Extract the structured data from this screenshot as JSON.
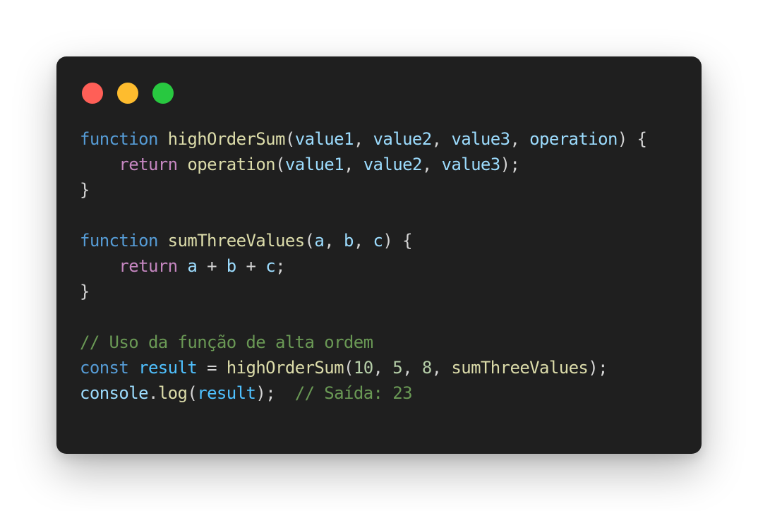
{
  "window": {
    "buttons": [
      {
        "name": "close",
        "color": "#ff5f57"
      },
      {
        "name": "minimize",
        "color": "#febc2e"
      },
      {
        "name": "zoom",
        "color": "#28c840"
      }
    ]
  },
  "colors": {
    "keyword": "#569cd6",
    "control": "#c586c0",
    "function": "#dcdcaa",
    "variable": "#9cdcfe",
    "number": "#b5cea8",
    "comment": "#6a9955",
    "punctuation": "#d4d4d4",
    "const": "#4fc1ff"
  },
  "code": {
    "lines": [
      [
        {
          "t": "function",
          "c": "keyword"
        },
        {
          "t": " ",
          "c": "punctuation"
        },
        {
          "t": "highOrderSum",
          "c": "function"
        },
        {
          "t": "(",
          "c": "punctuation"
        },
        {
          "t": "value1",
          "c": "variable"
        },
        {
          "t": ", ",
          "c": "punctuation"
        },
        {
          "t": "value2",
          "c": "variable"
        },
        {
          "t": ", ",
          "c": "punctuation"
        },
        {
          "t": "value3",
          "c": "variable"
        },
        {
          "t": ", ",
          "c": "punctuation"
        },
        {
          "t": "operation",
          "c": "variable"
        },
        {
          "t": ") {",
          "c": "punctuation"
        }
      ],
      [
        {
          "t": "    ",
          "c": "punctuation"
        },
        {
          "t": "return",
          "c": "control"
        },
        {
          "t": " ",
          "c": "punctuation"
        },
        {
          "t": "operation",
          "c": "function"
        },
        {
          "t": "(",
          "c": "punctuation"
        },
        {
          "t": "value1",
          "c": "variable"
        },
        {
          "t": ", ",
          "c": "punctuation"
        },
        {
          "t": "value2",
          "c": "variable"
        },
        {
          "t": ", ",
          "c": "punctuation"
        },
        {
          "t": "value3",
          "c": "variable"
        },
        {
          "t": ");",
          "c": "punctuation"
        }
      ],
      [
        {
          "t": "}",
          "c": "punctuation"
        }
      ],
      [],
      [
        {
          "t": "function",
          "c": "keyword"
        },
        {
          "t": " ",
          "c": "punctuation"
        },
        {
          "t": "sumThreeValues",
          "c": "function"
        },
        {
          "t": "(",
          "c": "punctuation"
        },
        {
          "t": "a",
          "c": "variable"
        },
        {
          "t": ", ",
          "c": "punctuation"
        },
        {
          "t": "b",
          "c": "variable"
        },
        {
          "t": ", ",
          "c": "punctuation"
        },
        {
          "t": "c",
          "c": "variable"
        },
        {
          "t": ") {",
          "c": "punctuation"
        }
      ],
      [
        {
          "t": "    ",
          "c": "punctuation"
        },
        {
          "t": "return",
          "c": "control"
        },
        {
          "t": " ",
          "c": "punctuation"
        },
        {
          "t": "a",
          "c": "variable"
        },
        {
          "t": " + ",
          "c": "punctuation"
        },
        {
          "t": "b",
          "c": "variable"
        },
        {
          "t": " + ",
          "c": "punctuation"
        },
        {
          "t": "c",
          "c": "variable"
        },
        {
          "t": ";",
          "c": "punctuation"
        }
      ],
      [
        {
          "t": "}",
          "c": "punctuation"
        }
      ],
      [],
      [
        {
          "t": "// Uso da função de alta ordem",
          "c": "comment"
        }
      ],
      [
        {
          "t": "const",
          "c": "keyword"
        },
        {
          "t": " ",
          "c": "punctuation"
        },
        {
          "t": "result",
          "c": "const"
        },
        {
          "t": " = ",
          "c": "punctuation"
        },
        {
          "t": "highOrderSum",
          "c": "function"
        },
        {
          "t": "(",
          "c": "punctuation"
        },
        {
          "t": "10",
          "c": "number"
        },
        {
          "t": ", ",
          "c": "punctuation"
        },
        {
          "t": "5",
          "c": "number"
        },
        {
          "t": ", ",
          "c": "punctuation"
        },
        {
          "t": "8",
          "c": "number"
        },
        {
          "t": ", ",
          "c": "punctuation"
        },
        {
          "t": "sumThreeValues",
          "c": "function"
        },
        {
          "t": ");",
          "c": "punctuation"
        }
      ],
      [
        {
          "t": "console",
          "c": "variable"
        },
        {
          "t": ".",
          "c": "punctuation"
        },
        {
          "t": "log",
          "c": "function"
        },
        {
          "t": "(",
          "c": "punctuation"
        },
        {
          "t": "result",
          "c": "const"
        },
        {
          "t": ");  ",
          "c": "punctuation"
        },
        {
          "t": "// Saída: 23",
          "c": "comment"
        }
      ]
    ]
  }
}
